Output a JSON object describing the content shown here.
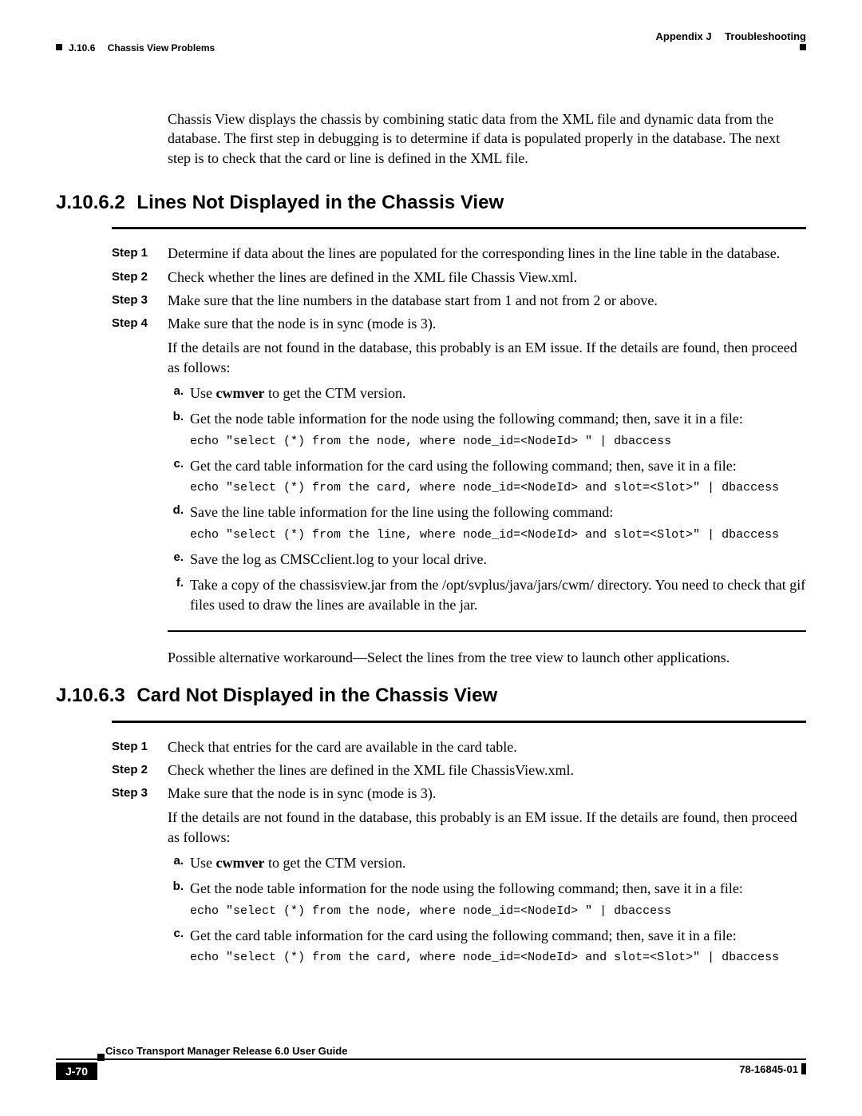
{
  "header": {
    "right": "Appendix J  Troubleshooting",
    "left": "J.10.6  Chassis View Problems"
  },
  "intro": "Chassis View displays the chassis by combining static data from the XML file and dynamic data from the database. The first step in debugging is to determine if data is populated properly in the database. The next step is to check that the card or line is defined in the XML file.",
  "sec1": {
    "num": "J.10.6.2",
    "title": "Lines Not Displayed in the Chassis View",
    "steps": {
      "s1": {
        "label": "Step 1",
        "text": "Determine if data about the lines are populated for the corresponding lines in the line table in the database."
      },
      "s2": {
        "label": "Step 2",
        "text": "Check whether the lines are defined in the XML file Chassis View.xml."
      },
      "s3": {
        "label": "Step 3",
        "text": "Make sure that the line numbers in the database start from 1 and not from 2 or above."
      },
      "s4": {
        "label": "Step 4",
        "text": "Make sure that the node is in sync (mode is 3)."
      },
      "s4note": "If the details are not found in the database, this probably is an EM issue. If the details are found, then proceed as follows:"
    },
    "items": {
      "a": {
        "lbl": "a.",
        "pre": "Use ",
        "bold": "cwmver",
        "post": " to get the CTM version."
      },
      "b": {
        "lbl": "b.",
        "text": "Get the node table information for the node using the following command; then, save it in a file:",
        "code": "echo \"select (*) from the node, where node_id=<NodeId> \" | dbaccess"
      },
      "c": {
        "lbl": "c.",
        "text": "Get the card table information for the card using the following command; then, save it in a file:",
        "code": "echo \"select (*) from the card, where node_id=<NodeId> and slot=<Slot>\" | dbaccess"
      },
      "d": {
        "lbl": "d.",
        "text": "Save the line table information for the line using the following command:",
        "code": "echo \"select (*) from the line, where node_id=<NodeId> and slot=<Slot>\" | dbaccess"
      },
      "e": {
        "lbl": "e.",
        "text": "Save the log as CMSCclient.log to your local drive."
      },
      "f": {
        "lbl": "f.",
        "text": "Take a copy of the chassisview.jar from the /opt/svplus/java/jars/cwm/ directory. You need to check that gif files used to draw the lines are available in the jar."
      }
    },
    "workaround": "Possible alternative workaround—Select the lines from the tree view to launch other applications."
  },
  "sec2": {
    "num": "J.10.6.3",
    "title": "Card Not Displayed in the Chassis View",
    "steps": {
      "s1": {
        "label": "Step 1",
        "text": "Check that entries for the card are available in the card table."
      },
      "s2": {
        "label": "Step 2",
        "text": "Check whether the lines are defined in the XML file ChassisView.xml."
      },
      "s3": {
        "label": "Step 3",
        "text": "Make sure that the node is in sync (mode is 3)."
      },
      "s3note": "If the details are not found in the database, this probably is an EM issue. If the details are found, then proceed as follows:"
    },
    "items": {
      "a": {
        "lbl": "a.",
        "pre": "Use ",
        "bold": "cwmver",
        "post": " to get the CTM version."
      },
      "b": {
        "lbl": "b.",
        "text": "Get the node table information for the node using the following command; then, save it in a file:",
        "code": "echo \"select (*) from the node, where node_id=<NodeId> \" | dbaccess"
      },
      "c": {
        "lbl": "c.",
        "text": "Get the card table information for the card using the following command; then, save it in a file:",
        "code": "echo \"select (*) from the card, where node_id=<NodeId> and slot=<Slot>\" | dbaccess"
      }
    }
  },
  "footer": {
    "book": "Cisco Transport Manager Release 6.0 User Guide",
    "page": "J-70",
    "doc": "78-16845-01"
  }
}
